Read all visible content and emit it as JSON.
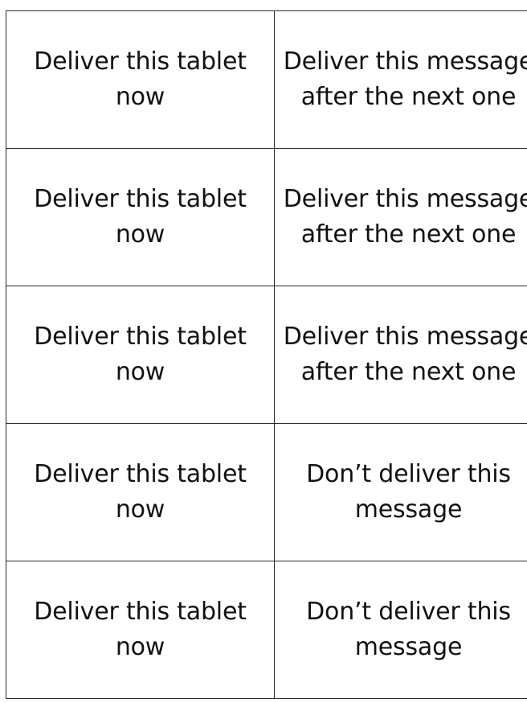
{
  "cards": [
    {
      "left": "Deliver this tablet now",
      "right": "Deliver this message after the next one"
    },
    {
      "left": "Deliver this tablet now",
      "right": "Deliver this message after the next one"
    },
    {
      "left": "Deliver this tablet now",
      "right": "Deliver this message after the next one"
    },
    {
      "left": "Deliver this tablet now",
      "right": "Don’t deliver this message"
    },
    {
      "left": "Deliver this tablet now",
      "right": "Don’t deliver this message"
    }
  ]
}
